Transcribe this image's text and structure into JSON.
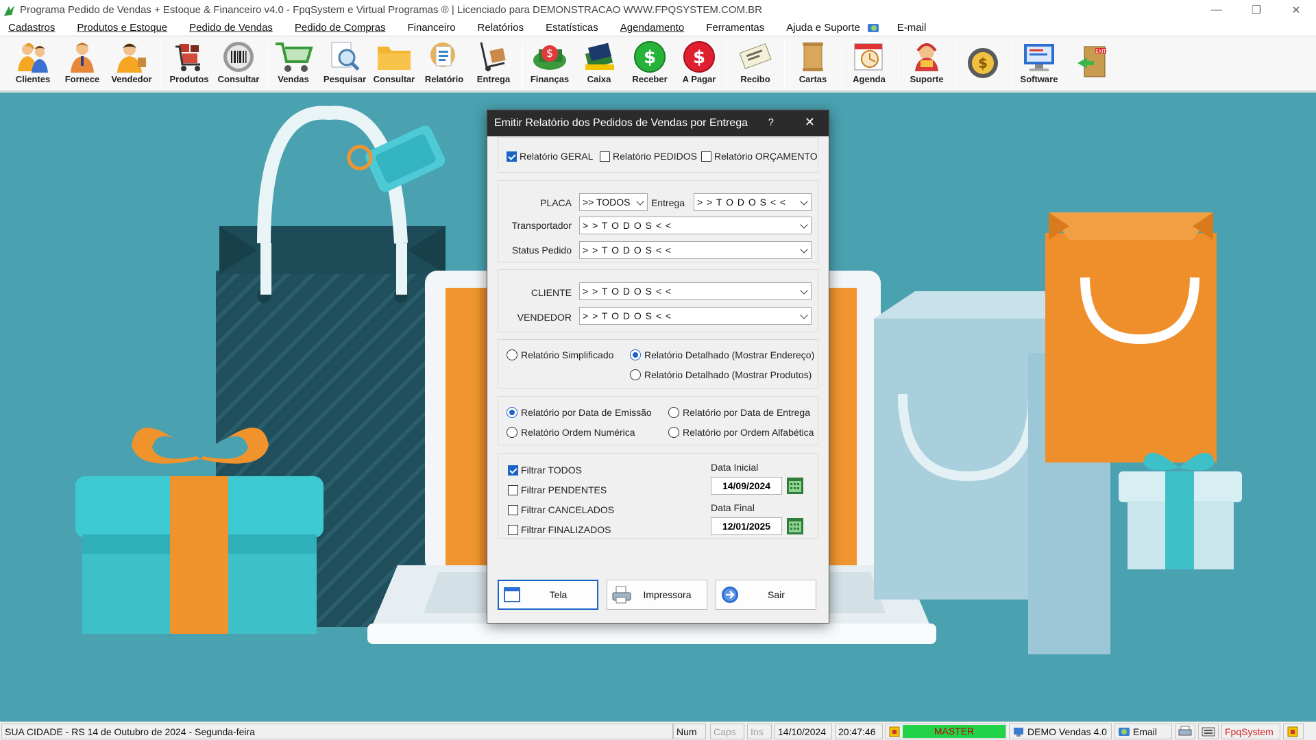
{
  "window": {
    "title": "Programa Pedido de Vendas + Estoque & Financeiro v4.0 - FpqSystem e Virtual Programas ® | Licenciado para  DEMONSTRACAO WWW.FPQSYSTEM.COM.BR",
    "minimize": "—",
    "restore": "❐",
    "close": "✕"
  },
  "menu": {
    "items": [
      "Cadastros",
      "Produtos e Estoque",
      "Pedido de Vendas",
      "Pedido de Compras",
      "Financeiro",
      "Relatórios",
      "Estatísticas",
      "Agendamento",
      "Ferramentas",
      "Ajuda e Suporte"
    ],
    "email": "E-mail"
  },
  "toolbar": {
    "buttons": [
      {
        "label": "Clientes",
        "icon": "people-icon"
      },
      {
        "label": "Fornece",
        "icon": "supplier-icon"
      },
      {
        "label": "Vendedor",
        "icon": "salesman-icon"
      },
      {
        "label": "Produtos",
        "icon": "cart-products-icon"
      },
      {
        "label": "Consultar",
        "icon": "barcode-icon"
      },
      {
        "label": "Vendas",
        "icon": "shopping-cart-icon"
      },
      {
        "label": "Pesquisar",
        "icon": "magnifier-icon"
      },
      {
        "label": "Consultar",
        "icon": "folder-icon"
      },
      {
        "label": "Relatório",
        "icon": "report-icon"
      },
      {
        "label": "Entrega",
        "icon": "hand-truck-icon"
      },
      {
        "label": "Finanças",
        "icon": "finance-icon"
      },
      {
        "label": "Caixa",
        "icon": "cash-register-icon"
      },
      {
        "label": "Receber",
        "icon": "green-dollar-icon"
      },
      {
        "label": "A Pagar",
        "icon": "red-dollar-icon"
      },
      {
        "label": "Recibo",
        "icon": "receipt-icon"
      },
      {
        "label": "Cartas",
        "icon": "scroll-icon"
      },
      {
        "label": "Agenda",
        "icon": "calendar-clock-icon"
      },
      {
        "label": "Suporte",
        "icon": "support-icon"
      },
      {
        "label": "",
        "icon": "coin-icon"
      },
      {
        "label": "Software",
        "icon": "software-icon"
      },
      {
        "label": "",
        "icon": "exit-icon"
      }
    ]
  },
  "dialog": {
    "title": "Emitir Relatório dos Pedidos de Vendas por Entrega",
    "help": "?",
    "close": "✕",
    "report_types": [
      {
        "label": "Relatório GERAL",
        "checked": true
      },
      {
        "label": "Relatório PEDIDOS",
        "checked": false
      },
      {
        "label": "Relatório ORÇAMENTO",
        "checked": false
      }
    ],
    "filters": {
      "placa_label": "PLACA",
      "placa_value": ">> TODOS",
      "entrega_label": "Entrega",
      "entrega_value": "> > T O D O S < <",
      "transportador_label": "Transportador",
      "transportador_value": "> > T O D O S < <",
      "status_label": "Status Pedido",
      "status_value": "> > T O D O S < <",
      "cliente_label": "CLIENTE",
      "cliente_value": "> > T O D O S < <",
      "vendedor_label": "VENDEDOR",
      "vendedor_value": "> > T O D O S < <"
    },
    "detail_options": {
      "simplificado": "Relatório Simplificado",
      "endereco": "Relatório Detalhado (Mostrar Endereço)",
      "produtos": "Relatório Detalhado (Mostrar Produtos)",
      "selected": "endereco"
    },
    "order_options": {
      "emissao": "Relatório por Data de Emissão",
      "entrega": "Relatório por Data de Entrega",
      "numerica": "Relatório Ordem Numérica",
      "alfabetica": "Relatório por Ordem Alfabética",
      "selected": "emissao"
    },
    "status_filters": [
      {
        "label": "Filtrar TODOS",
        "checked": true
      },
      {
        "label": "Filtrar PENDENTES",
        "checked": false
      },
      {
        "label": "Filtrar CANCELADOS",
        "checked": false
      },
      {
        "label": "Filtrar FINALIZADOS",
        "checked": false
      }
    ],
    "data_inicial_label": "Data Inicial",
    "data_inicial": "14/09/2024",
    "data_final_label": "Data Final",
    "data_final": "12/01/2025",
    "buttons": {
      "tela": "Tela",
      "impressora": "Impressora",
      "sair": "Sair"
    }
  },
  "statusbar": {
    "city": "SUA CIDADE - RS 14 de Outubro de 2024 - Segunda-feira",
    "num": "Num",
    "caps": "Caps",
    "ins": "Ins",
    "date": "14/10/2024",
    "time": "20:47:46",
    "master": "MASTER",
    "demo": "DEMO Vendas 4.0",
    "email": "Email",
    "brand": "FpqSystem"
  },
  "colors": {
    "desktop": "#4aa1b0",
    "accent": "#1a64c6",
    "master_green": "#22d34a",
    "brand_red": "#d62020"
  }
}
